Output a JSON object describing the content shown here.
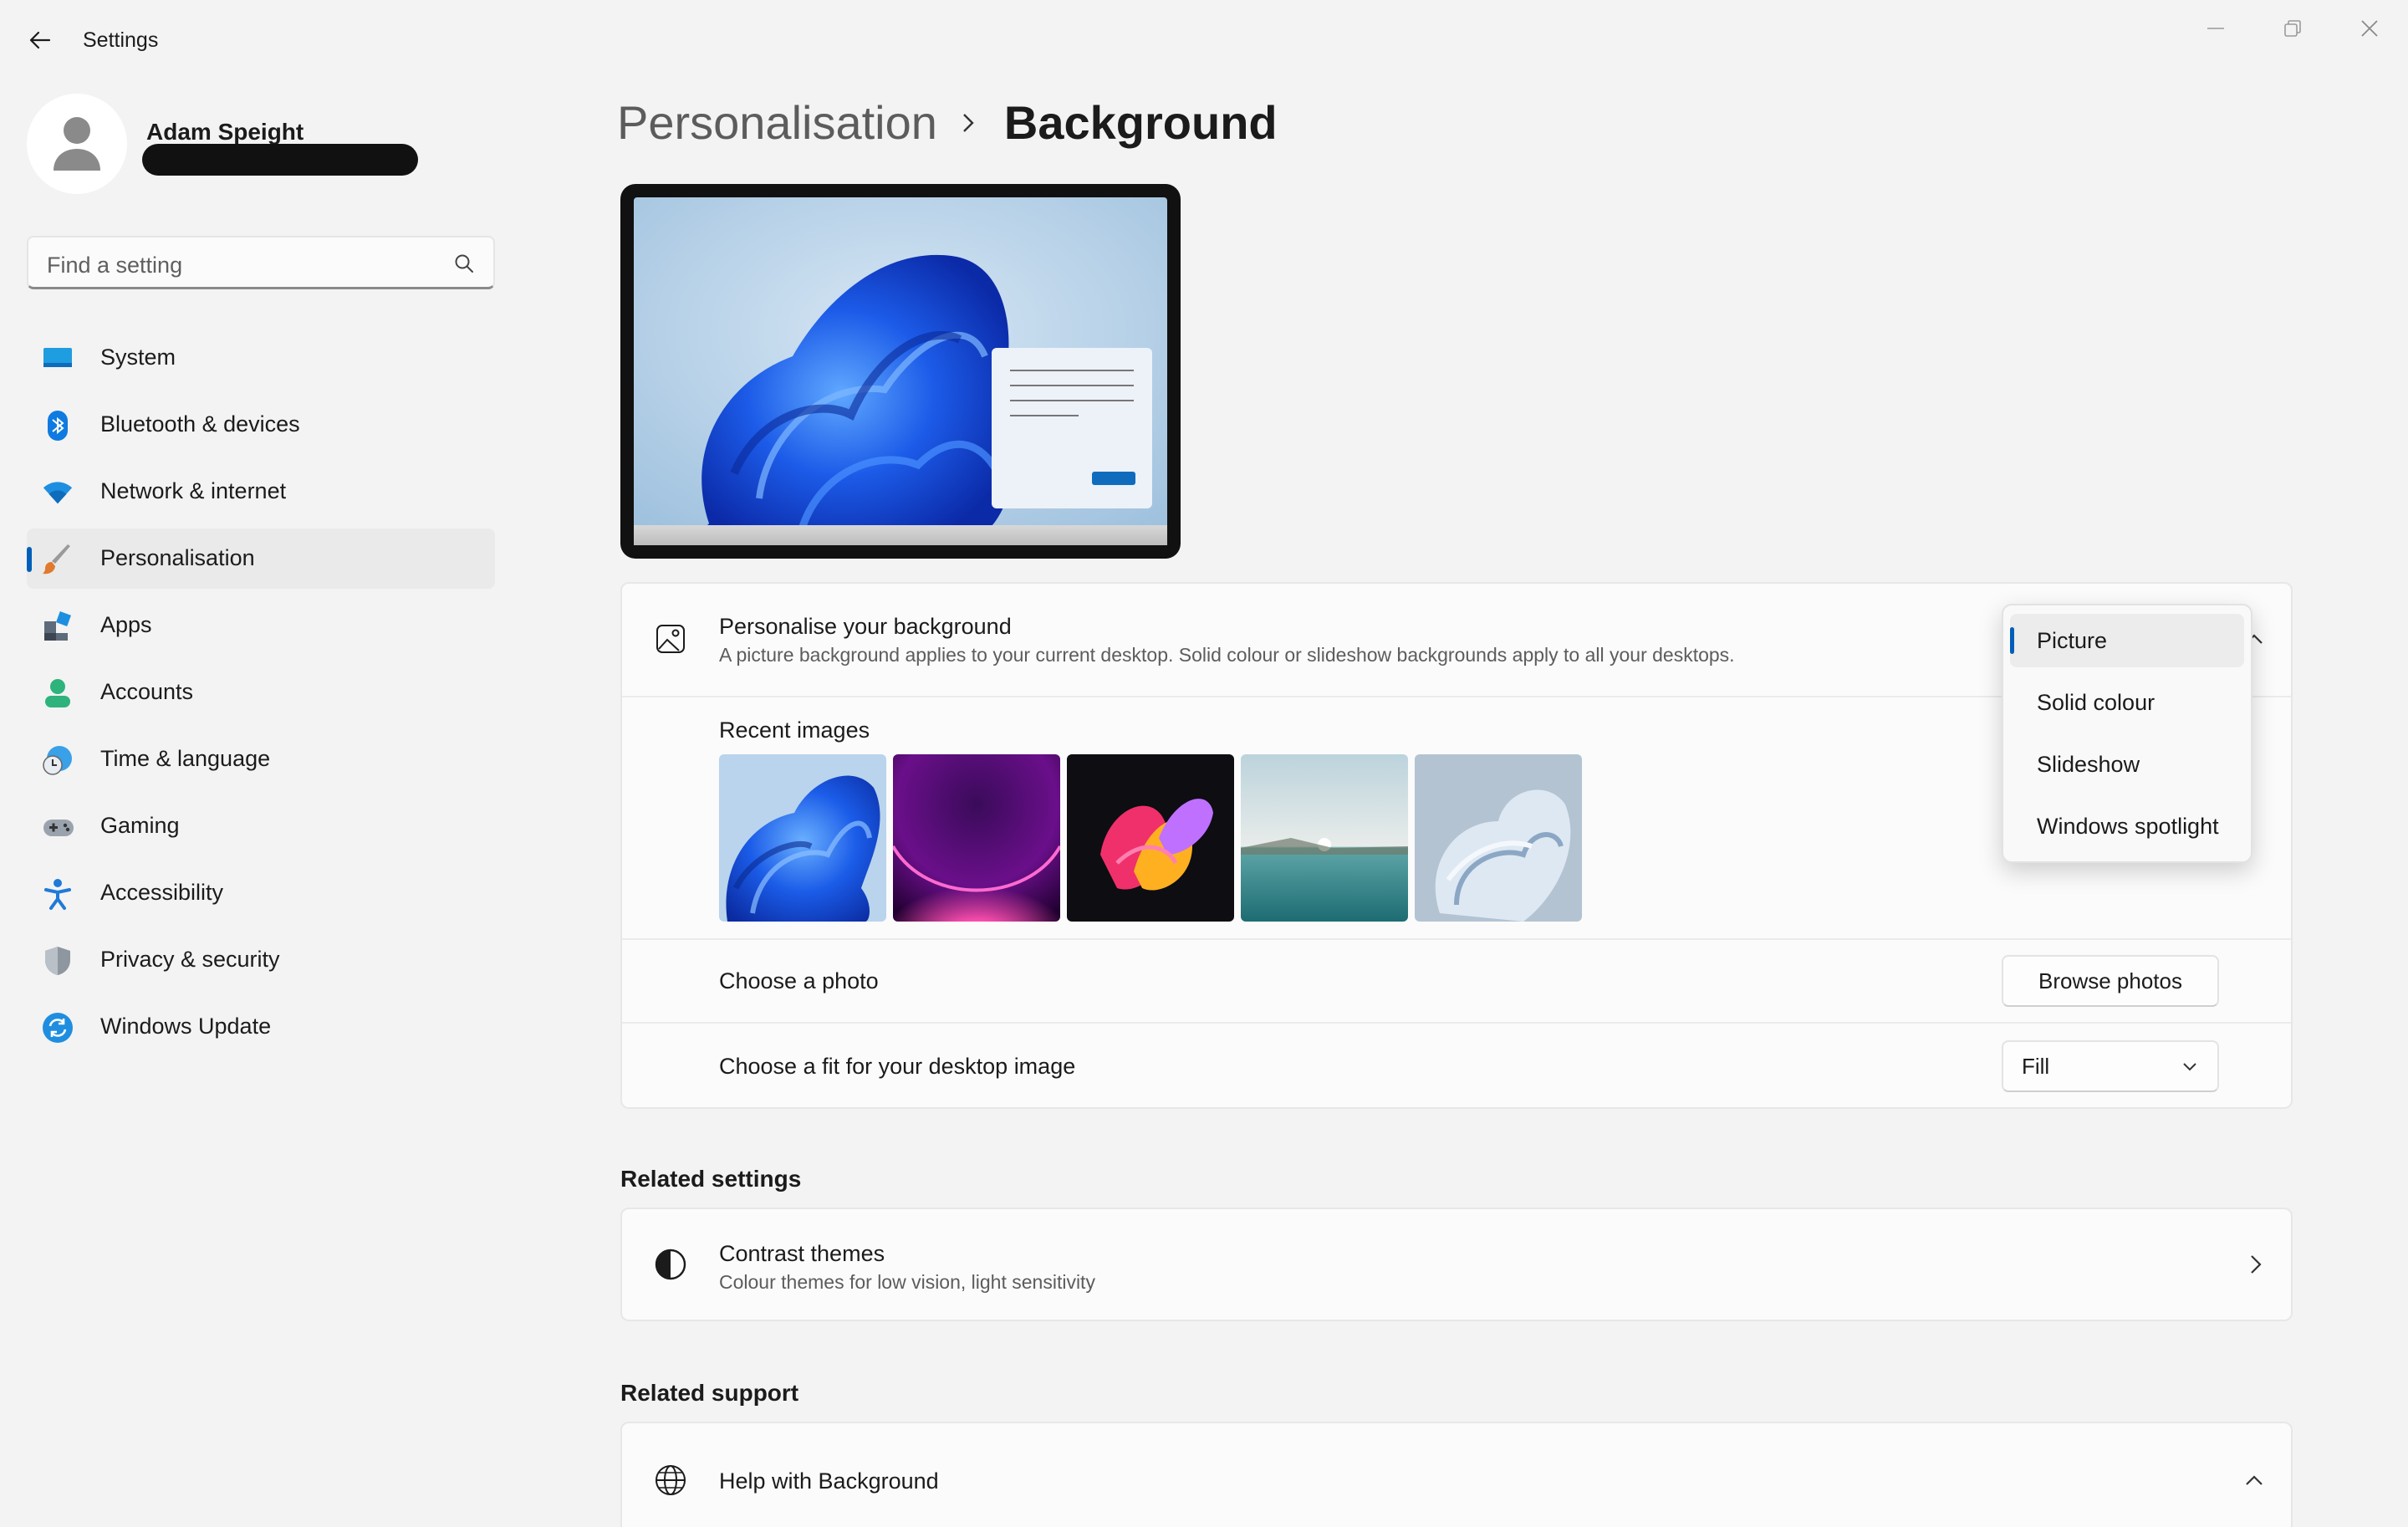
{
  "app": {
    "title": "Settings"
  },
  "user": {
    "name": "Adam Speight"
  },
  "search": {
    "placeholder": "Find a setting"
  },
  "sidebar": {
    "items": [
      {
        "label": "System",
        "icon": "system-icon"
      },
      {
        "label": "Bluetooth & devices",
        "icon": "bluetooth-icon"
      },
      {
        "label": "Network & internet",
        "icon": "wifi-icon"
      },
      {
        "label": "Personalisation",
        "icon": "brush-icon",
        "active": true
      },
      {
        "label": "Apps",
        "icon": "apps-icon"
      },
      {
        "label": "Accounts",
        "icon": "accounts-icon"
      },
      {
        "label": "Time & language",
        "icon": "clock-globe-icon"
      },
      {
        "label": "Gaming",
        "icon": "gamepad-icon"
      },
      {
        "label": "Accessibility",
        "icon": "accessibility-icon"
      },
      {
        "label": "Privacy & security",
        "icon": "shield-icon"
      },
      {
        "label": "Windows Update",
        "icon": "update-icon"
      }
    ]
  },
  "breadcrumb": {
    "parent": "Personalisation",
    "current": "Background"
  },
  "background": {
    "title": "Personalise your background",
    "subtitle": "A picture background applies to your current desktop. Solid colour or slideshow backgrounds apply to all your desktops.",
    "recent_label": "Recent images",
    "choose_photo_label": "Choose a photo",
    "browse_label": "Browse photos",
    "fit_label": "Choose a fit for your desktop image",
    "fit_value": "Fill",
    "options": [
      "Picture",
      "Solid colour",
      "Slideshow",
      "Windows spotlight"
    ],
    "selected_option": "Picture"
  },
  "related_settings": {
    "heading": "Related settings",
    "contrast_title": "Contrast themes",
    "contrast_sub": "Colour themes for low vision, light sensitivity"
  },
  "related_support": {
    "heading": "Related support",
    "help_title": "Help with Background"
  },
  "colors": {
    "accent": "#005fb8",
    "window_bg": "#f3f3f3",
    "card_bg": "#fbfbfb"
  }
}
